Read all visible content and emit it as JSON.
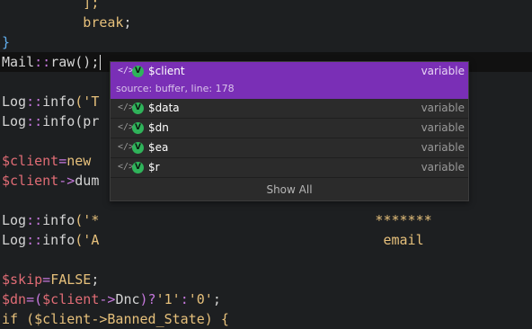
{
  "editor": {
    "lines": [
      {
        "parts": [
          {
            "t": "          ];",
            "c": "t-key"
          }
        ]
      },
      {
        "parts": [
          {
            "t": "          break",
            "c": "t-key"
          },
          {
            "t": ";",
            "c": "t-plain"
          }
        ]
      },
      {
        "parts": [
          {
            "t": "}",
            "c": "t-brace"
          }
        ]
      },
      {
        "parts": [
          {
            "t": "Mail",
            "c": "t-plain"
          },
          {
            "t": "::",
            "c": "t-op"
          },
          {
            "t": "raw",
            "c": "t-fn"
          },
          {
            "t": "();",
            "c": "t-plain"
          }
        ],
        "current": true
      },
      {
        "parts": []
      },
      {
        "parts": [
          {
            "t": "Log",
            "c": "t-plain"
          },
          {
            "t": "::",
            "c": "t-op"
          },
          {
            "t": "info",
            "c": "t-fn"
          },
          {
            "t": "('T",
            "c": "t-str"
          }
        ]
      },
      {
        "parts": [
          {
            "t": "Log",
            "c": "t-plain"
          },
          {
            "t": "::",
            "c": "t-op"
          },
          {
            "t": "info",
            "c": "t-fn"
          },
          {
            "t": "(pr",
            "c": "t-plain"
          }
        ]
      },
      {
        "parts": []
      },
      {
        "parts": [
          {
            "t": "$client",
            "c": "t-var"
          },
          {
            "t": "=",
            "c": "t-op"
          },
          {
            "t": "new",
            "c": "t-key"
          }
        ]
      },
      {
        "parts": [
          {
            "t": "$client",
            "c": "t-var"
          },
          {
            "t": "->",
            "c": "t-op"
          },
          {
            "t": "dum",
            "c": "t-plain"
          }
        ]
      },
      {
        "parts": []
      },
      {
        "parts": [
          {
            "t": "Log",
            "c": "t-plain"
          },
          {
            "t": "::",
            "c": "t-op"
          },
          {
            "t": "info",
            "c": "t-fn"
          },
          {
            "t": "('*",
            "c": "t-str"
          },
          {
            "t": "                                  *******",
            "c": "t-str"
          }
        ]
      },
      {
        "parts": [
          {
            "t": "Log",
            "c": "t-plain"
          },
          {
            "t": "::",
            "c": "t-op"
          },
          {
            "t": "info",
            "c": "t-fn"
          },
          {
            "t": "('A",
            "c": "t-str"
          },
          {
            "t": "                                   email",
            "c": "t-str"
          }
        ]
      },
      {
        "parts": []
      },
      {
        "parts": [
          {
            "t": "$skip",
            "c": "t-var"
          },
          {
            "t": "=",
            "c": "t-op"
          },
          {
            "t": "FALSE",
            "c": "t-key"
          },
          {
            "t": ";",
            "c": "t-plain"
          }
        ]
      },
      {
        "parts": [
          {
            "t": "$dn",
            "c": "t-var"
          },
          {
            "t": "=(",
            "c": "t-op"
          },
          {
            "t": "$client",
            "c": "t-var"
          },
          {
            "t": "->",
            "c": "t-op"
          },
          {
            "t": "Dnc",
            "c": "t-plain"
          },
          {
            "t": ")?",
            "c": "t-op"
          },
          {
            "t": "'1'",
            "c": "t-str"
          },
          {
            "t": ":",
            "c": "t-op"
          },
          {
            "t": "'0'",
            "c": "t-str"
          },
          {
            "t": ";",
            "c": "t-plain"
          }
        ]
      },
      {
        "parts": [
          {
            "t": "if ($client->Banned_State) {",
            "c": "t-key"
          }
        ]
      }
    ]
  },
  "autocomplete": {
    "items": [
      {
        "name": "$client",
        "type": "variable",
        "code": "</>",
        "badge": "V",
        "detail": "source: buffer, line: 178"
      },
      {
        "name": "$data",
        "type": "variable",
        "code": "</>",
        "badge": "V"
      },
      {
        "name": "$dn",
        "type": "variable",
        "code": "</>",
        "badge": "V"
      },
      {
        "name": "$ea",
        "type": "variable",
        "code": "</>",
        "badge": "V"
      },
      {
        "name": "$r",
        "type": "variable",
        "code": "</>",
        "badge": "V"
      }
    ],
    "show_all": "Show All"
  }
}
